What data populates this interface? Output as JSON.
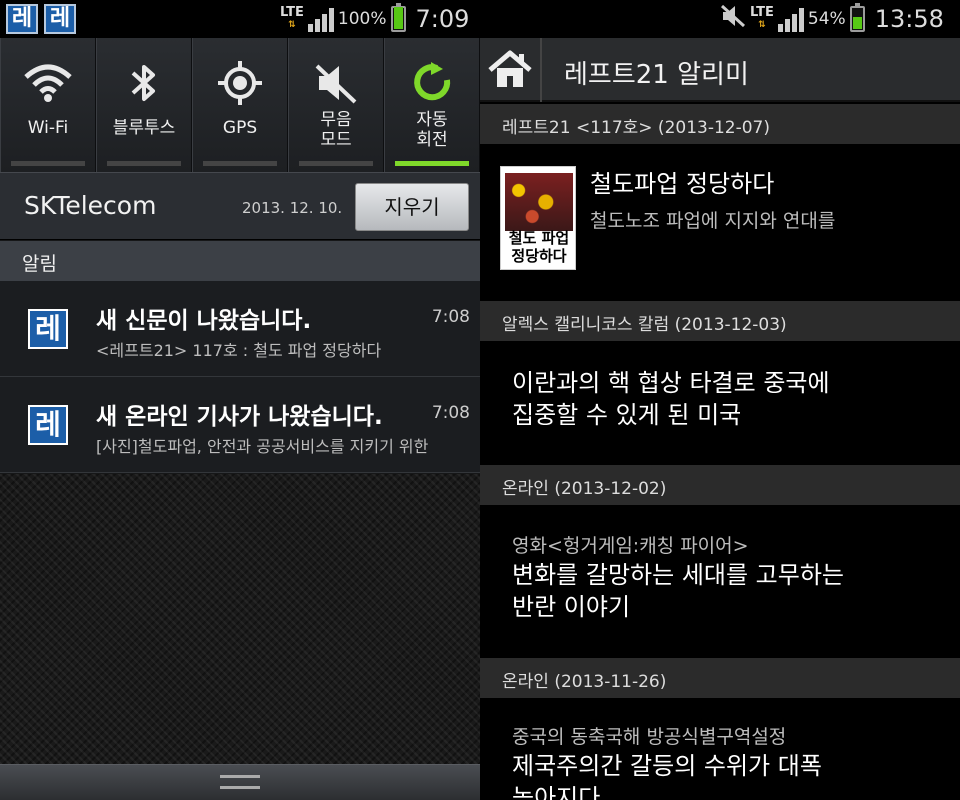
{
  "left": {
    "status": {
      "app_icons": [
        "레",
        "레"
      ],
      "network": "LTE",
      "battery_pct": "100%",
      "battery_level": 1.0,
      "time": "7:09"
    },
    "quick_settings": [
      {
        "label": "Wi-Fi",
        "icon": "wifi-icon",
        "on": false
      },
      {
        "label": "블루투스",
        "icon": "bluetooth-icon",
        "on": false
      },
      {
        "label": "GPS",
        "icon": "gps-icon",
        "on": false
      },
      {
        "label": "무음\n모드",
        "icon": "mute-icon",
        "on": false
      },
      {
        "label": "자동\n회전",
        "icon": "auto-rotate-icon",
        "on": true
      }
    ],
    "carrier": "SKTelecom",
    "date": "2013. 12. 10.",
    "clear_label": "지우기",
    "section_label": "알림",
    "notifications": [
      {
        "icon_text": "레",
        "title": "새 신문이 나왔습니다.",
        "time": "7:08",
        "sub": "<레프트21> 117호 : 철도 파업 정당하다"
      },
      {
        "icon_text": "레",
        "title": "새 온라인 기사가 나왔습니다.",
        "time": "7:08",
        "sub": "[사진]철도파업, 안전과 공공서비스를 지키기 위한"
      }
    ]
  },
  "right": {
    "status": {
      "network": "LTE",
      "battery_pct": "54%",
      "battery_level": 0.54,
      "time": "13:58"
    },
    "app_title": "레프트21 알리미",
    "sections": [
      {
        "header": "레프트21 <117호> (2013-12-07)",
        "title": "철도파업 정당하다",
        "sub": "철도노조 파업에 지지와 연대를",
        "thumb_text": "철도 파업\n정당하다"
      },
      {
        "header": "알렉스 캘리니코스 칼럼 (2013-12-03)",
        "title": "이란과의 핵 협상 타결로 중국에\n집중할 수 있게 된 미국"
      },
      {
        "header": "온라인 (2013-12-02)",
        "kicker": "영화<헝거게임:캐칭 파이어>",
        "title": "변화를 갈망하는 세대를 고무하는\n반란 이야기"
      },
      {
        "header": "온라인 (2013-11-26)",
        "kicker": "중국의 동축국해 방공식별구역설정",
        "title": "제국주의간 갈등의 수위가 대폭\n높아지다"
      }
    ]
  },
  "colors": {
    "accent_green": "#7fd82a",
    "brand_blue": "#1c5ea8"
  }
}
